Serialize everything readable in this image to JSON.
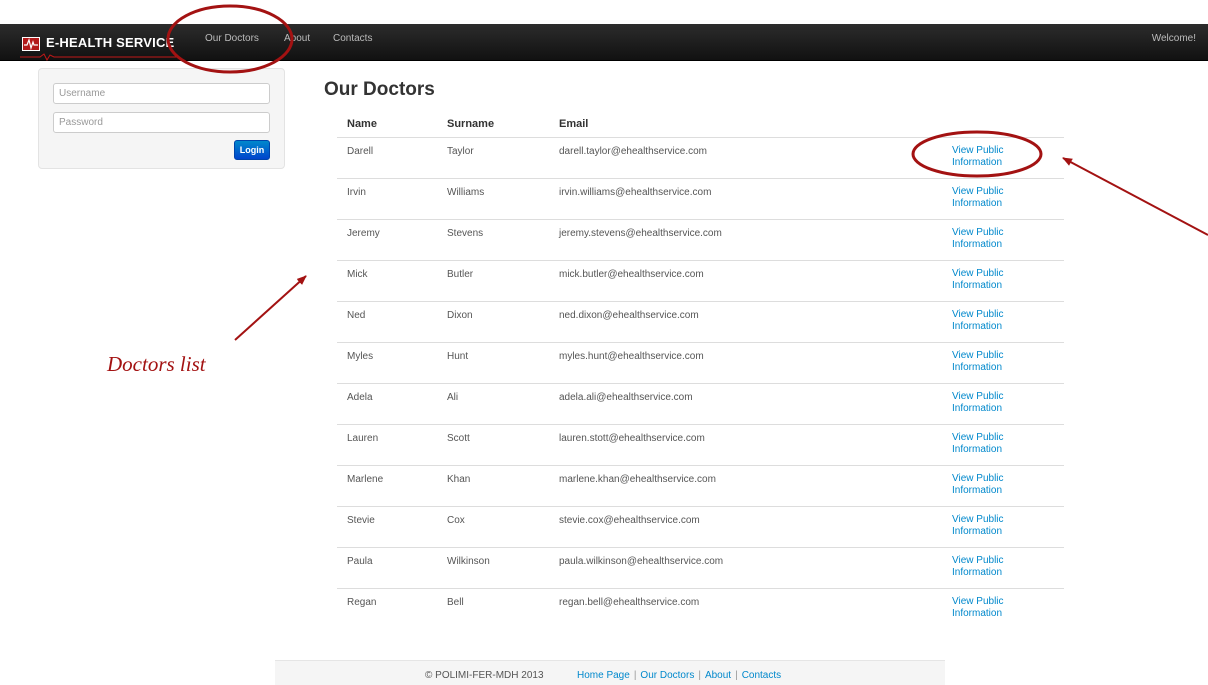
{
  "navbar": {
    "brand": "E-HEALTH SERVICE",
    "links": [
      "Our Doctors",
      "About",
      "Contacts"
    ],
    "welcome": "Welcome!"
  },
  "login": {
    "username_placeholder": "Username",
    "password_placeholder": "Password",
    "login_label": "Login"
  },
  "doctors": {
    "title": "Our Doctors",
    "columns": [
      "Name",
      "Surname",
      "Email"
    ],
    "link_text": [
      "View Public",
      "Information"
    ],
    "rows": [
      {
        "name": "Darell",
        "surname": "Taylor",
        "email": "darell.taylor@ehealthservice.com"
      },
      {
        "name": "Irvin",
        "surname": "Williams",
        "email": "irvin.williams@ehealthservice.com"
      },
      {
        "name": "Jeremy",
        "surname": "Stevens",
        "email": "jeremy.stevens@ehealthservice.com"
      },
      {
        "name": "Mick",
        "surname": "Butler",
        "email": "mick.butler@ehealthservice.com"
      },
      {
        "name": "Ned",
        "surname": "Dixon",
        "email": "ned.dixon@ehealthservice.com"
      },
      {
        "name": "Myles",
        "surname": "Hunt",
        "email": "myles.hunt@ehealthservice.com"
      },
      {
        "name": "Adela",
        "surname": "Ali",
        "email": "adela.ali@ehealthservice.com"
      },
      {
        "name": "Lauren",
        "surname": "Scott",
        "email": "lauren.stott@ehealthservice.com"
      },
      {
        "name": "Marlene",
        "surname": "Khan",
        "email": "marlene.khan@ehealthservice.com"
      },
      {
        "name": "Stevie",
        "surname": "Cox",
        "email": "stevie.cox@ehealthservice.com"
      },
      {
        "name": "Paula",
        "surname": "Wilkinson",
        "email": "paula.wilkinson@ehealthservice.com"
      },
      {
        "name": "Regan",
        "surname": "Bell",
        "email": "regan.bell@ehealthservice.com"
      }
    ]
  },
  "annotation": {
    "label": "Doctors list",
    "color": "#a31212"
  },
  "footer": {
    "copyright": "© POLIMI-FER-MDH 2013",
    "links": [
      "Home Page",
      "Our Doctors",
      "About",
      "Contacts"
    ],
    "separator": "|"
  },
  "colors": {
    "navbar": "#1b1b1b",
    "link": "#0088cc",
    "button": "#0055cc"
  }
}
